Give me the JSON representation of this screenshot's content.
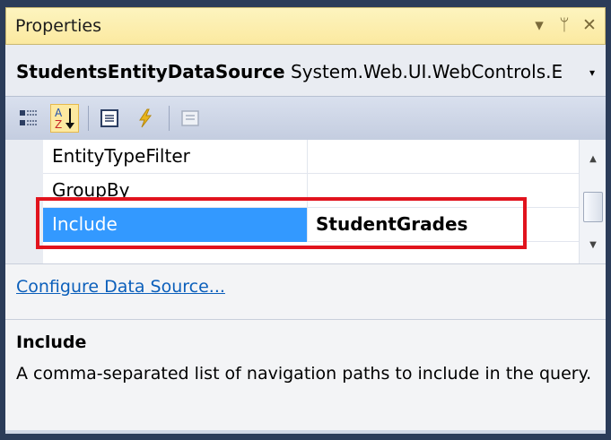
{
  "window": {
    "title": "Properties",
    "buttons": {
      "dropdown": "▾",
      "pin": "ᛘ",
      "close": "✕"
    }
  },
  "selector": {
    "object_name": "StudentsEntityDataSource",
    "object_type": "System.Web.UI.WebControls.E",
    "dropdown_glyph": "▾"
  },
  "toolbar": {
    "tools": [
      {
        "name": "categorized",
        "icon": "categorized-icon"
      },
      {
        "name": "alphabetical",
        "icon": "alphabetical-icon",
        "active": true
      },
      {
        "name": "properties",
        "icon": "properties-icon"
      },
      {
        "name": "events",
        "icon": "events-icon"
      },
      {
        "name": "property-pages",
        "icon": "property-pages-icon"
      }
    ]
  },
  "grid": {
    "rows": [
      {
        "name": "EntityTypeFilter",
        "value": ""
      },
      {
        "name": "GroupBy",
        "value": ""
      },
      {
        "name": "Include",
        "value": "StudentGrades",
        "selected": true
      }
    ]
  },
  "commands": {
    "configure_link": "Configure Data Source..."
  },
  "description": {
    "title": "Include",
    "text": "A comma-separated list of navigation paths to include in the query."
  },
  "colors": {
    "selection": "#3399ff",
    "highlight_box": "#e1131d",
    "link": "#0b5fbb"
  }
}
